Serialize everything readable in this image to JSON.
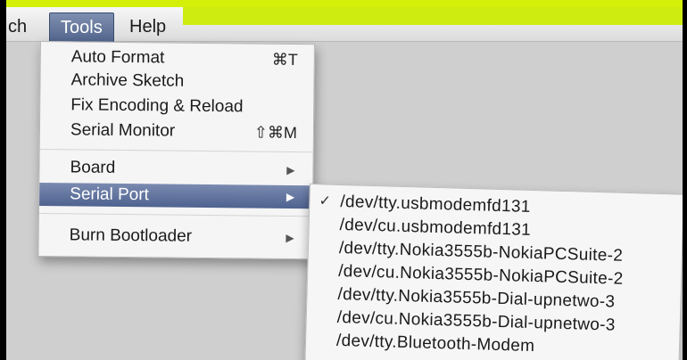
{
  "menubar": {
    "items": [
      "ch",
      "Tools",
      "Help"
    ]
  },
  "tools_menu": {
    "items": [
      {
        "label": "Auto Format",
        "shortcut": "⌘T"
      },
      {
        "label": "Archive Sketch",
        "shortcut": ""
      },
      {
        "label": "Fix Encoding & Reload",
        "shortcut": ""
      },
      {
        "label": "Serial Monitor",
        "shortcut": "⇧⌘M"
      },
      {
        "label": "Board",
        "shortcut": "▶"
      },
      {
        "label": "Serial Port",
        "shortcut": "▶"
      },
      {
        "label": "Burn Bootloader",
        "shortcut": "▶"
      }
    ]
  },
  "serial_port_submenu": {
    "checkmark": "✓",
    "items": [
      "/dev/tty.usbmodemfd131",
      "/dev/cu.usbmodemfd131",
      "/dev/tty.Nokia3555b-NokiaPCSuite-2",
      "/dev/cu.Nokia3555b-NokiaPCSuite-2",
      "/dev/tty.Nokia3555b-Dial-upnetwo-3",
      "/dev/cu.Nokia3555b-Dial-upnetwo-3",
      "/dev/tty.Bluetooth-Modem"
    ]
  },
  "colors": {
    "accent": "#cfec10",
    "highlight": "#52658c",
    "background": "#cfcfcf"
  }
}
